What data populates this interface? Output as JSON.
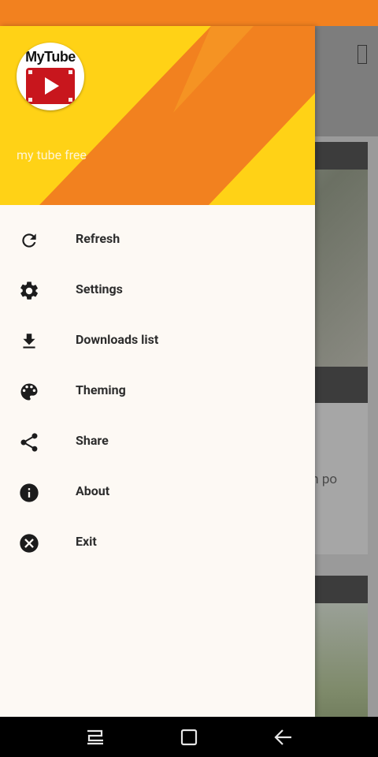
{
  "drawer": {
    "app_logo_text": "MyTube",
    "subtitle": "my tube free",
    "items": [
      {
        "label": "Refresh",
        "icon": "refresh-icon"
      },
      {
        "label": "Settings",
        "icon": "gear-icon"
      },
      {
        "label": "Downloads list",
        "icon": "download-icon"
      },
      {
        "label": "Theming",
        "icon": "palette-icon"
      },
      {
        "label": "Share",
        "icon": "share-icon"
      },
      {
        "label": "About",
        "icon": "info-icon"
      },
      {
        "label": "Exit",
        "icon": "close-circle-icon"
      }
    ]
  },
  "background": {
    "visible_text": "an po"
  },
  "colors": {
    "status_bar": "#f2811f",
    "header_yellow": "#ffd216",
    "header_orange": "#f2811f",
    "drawer_bg": "#fdf9f4"
  },
  "nav_bar": {
    "buttons": [
      "recent-apps-icon",
      "home-icon",
      "back-icon"
    ]
  }
}
